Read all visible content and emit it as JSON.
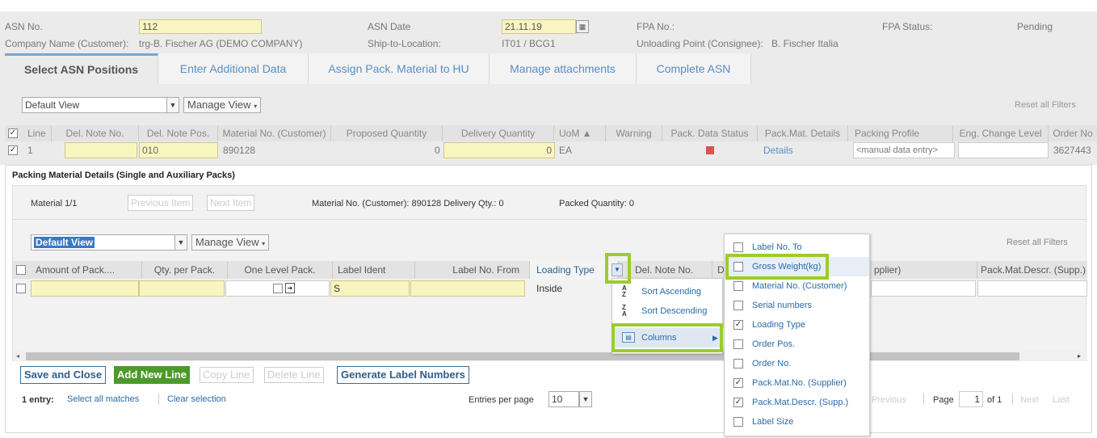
{
  "header": {
    "asn_no_label": "ASN No.",
    "asn_no_value": "112",
    "asn_date_label": "ASN Date",
    "asn_date_value": "21.11.19",
    "fpa_no_label": "FPA No.:",
    "fpa_status_label": "FPA Status:",
    "fpa_status_value": "Pending",
    "company_label": "Company Name (Customer):",
    "company_value": "trg-B. Fischer AG (DEMO COMPANY)",
    "ship_to_label": "Ship-to-Location:",
    "ship_to_value": "IT01 / BCG1",
    "unloading_label": "Unloading Point (Consignee):",
    "unloading_value": "B. Fischer Italia"
  },
  "tabs": [
    {
      "label": "Select ASN Positions"
    },
    {
      "label": "Enter Additional Data"
    },
    {
      "label": "Assign Pack. Material to HU"
    },
    {
      "label": "Manage attachments"
    },
    {
      "label": "Complete ASN"
    }
  ],
  "top_view": {
    "view_value": "Default View",
    "manage_view": "Manage View",
    "reset_filters": "Reset all Filters"
  },
  "asn_table": {
    "columns": [
      "Line",
      "Del. Note No.",
      "Del. Note Pos.",
      "Material No. (Customer)",
      "Proposed Quantity",
      "Delivery Quantity",
      "UoM ▲",
      "Warning",
      "Pack. Data Status",
      "Pack.Mat. Details",
      "Packing Profile",
      "Eng. Change Level",
      "Order No"
    ],
    "row": {
      "line": "1",
      "del_note_pos": "010",
      "material_no": "890128",
      "proposed_qty": "0",
      "delivery_qty": "0",
      "uom": "EA",
      "details": "Details",
      "packing_profile": "<manual data entry>",
      "order_no": "3627443"
    }
  },
  "packing": {
    "title": "Packing Material Details (Single and Auxiliary Packs)",
    "material_counter": "Material 1/1",
    "prev_item": "Previous Item",
    "next_item": "Next Item",
    "material_info": "Material No. (Customer): 890128  Delivery Qty.: 0",
    "packed_qty": "Packed Quantity: 0",
    "view_value": "Default View",
    "manage_view": "Manage View",
    "reset_filters": "Reset all Filters",
    "columns": [
      "Amount of Pack....",
      "Qty. per Pack.",
      "One Level Pack.",
      "Label Ident",
      "Label No. From",
      "Loading Type",
      "Del. Note No.",
      "De",
      "pplier)",
      "Pack.Mat.Descr. (Supp.)"
    ],
    "row": {
      "label_ident": "S",
      "loading_type": "Inside"
    },
    "buttons": {
      "save_close": "Save and Close",
      "add_line": "Add New Line",
      "copy_line": "Copy Line",
      "delete_line": "Delete Line",
      "generate": "Generate Label Numbers"
    },
    "footer": {
      "entries": "1 entry:",
      "select_all": "Select all matches",
      "clear_selection": "Clear selection",
      "entries_per_page_label": "Entries per page",
      "entries_per_page_value": "10",
      "previous": "Previous",
      "page_label": "Page",
      "page_value": "1",
      "of_total": "of 1",
      "next": "Next",
      "last": "Last"
    }
  },
  "context_menu": {
    "sort_asc": "Sort Ascending",
    "sort_desc": "Sort Descending",
    "columns": "Columns"
  },
  "column_menu": [
    {
      "label": "Label No. To",
      "checked": false
    },
    {
      "label": "Gross Weight(kg)",
      "checked": false
    },
    {
      "label": "Material No. (Customer)",
      "checked": false
    },
    {
      "label": "Serial numbers",
      "checked": false
    },
    {
      "label": "Loading Type",
      "checked": true
    },
    {
      "label": "Order Pos.",
      "checked": false
    },
    {
      "label": "Order No.",
      "checked": false
    },
    {
      "label": "Pack.Mat.No. (Supplier)",
      "checked": true
    },
    {
      "label": "Pack.Mat.Descr. (Supp.)",
      "checked": true
    },
    {
      "label": "Label Size",
      "checked": false
    }
  ],
  "colors": {
    "highlight": "#9ccc2a",
    "field_yellow": "#f8f5c0",
    "link_blue": "#2b6aa8",
    "status_red": "#d9534f",
    "add_green": "#4c9a2a"
  }
}
